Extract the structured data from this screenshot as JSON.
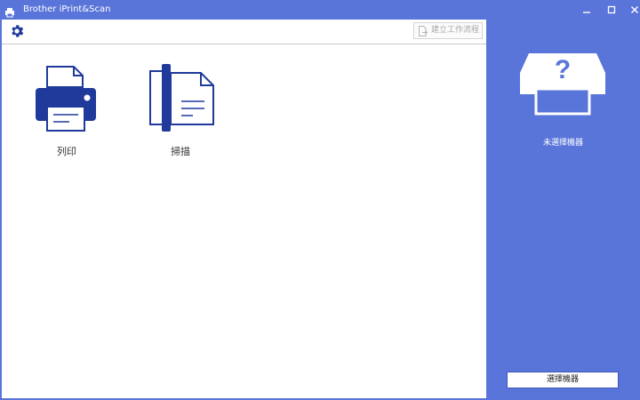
{
  "window": {
    "title": "Brother iPrint&Scan",
    "icons": {
      "app": "printer-app-icon",
      "minimize": "minimize-icon",
      "maximize": "maximize-icon",
      "close": "close-icon"
    }
  },
  "toolbar": {
    "settings_icon": "gear-icon",
    "create_workflow_label": "建立工作流程",
    "create_workflow_icon": "workflow-document-icon"
  },
  "tiles": [
    {
      "label": "列印",
      "icon": "printer-icon"
    },
    {
      "label": "掃描",
      "icon": "scanner-icon"
    }
  ],
  "side_panel": {
    "device_icon": "unknown-device-icon",
    "device_placeholder_glyph": "?",
    "no_device_text": "未選擇機器",
    "select_device_label": "選擇機器"
  },
  "colors": {
    "accent": "#5a75d9",
    "icon_blue": "#1f3a9a",
    "disabled_text": "#a8a8a8",
    "background": "#ffffff"
  }
}
